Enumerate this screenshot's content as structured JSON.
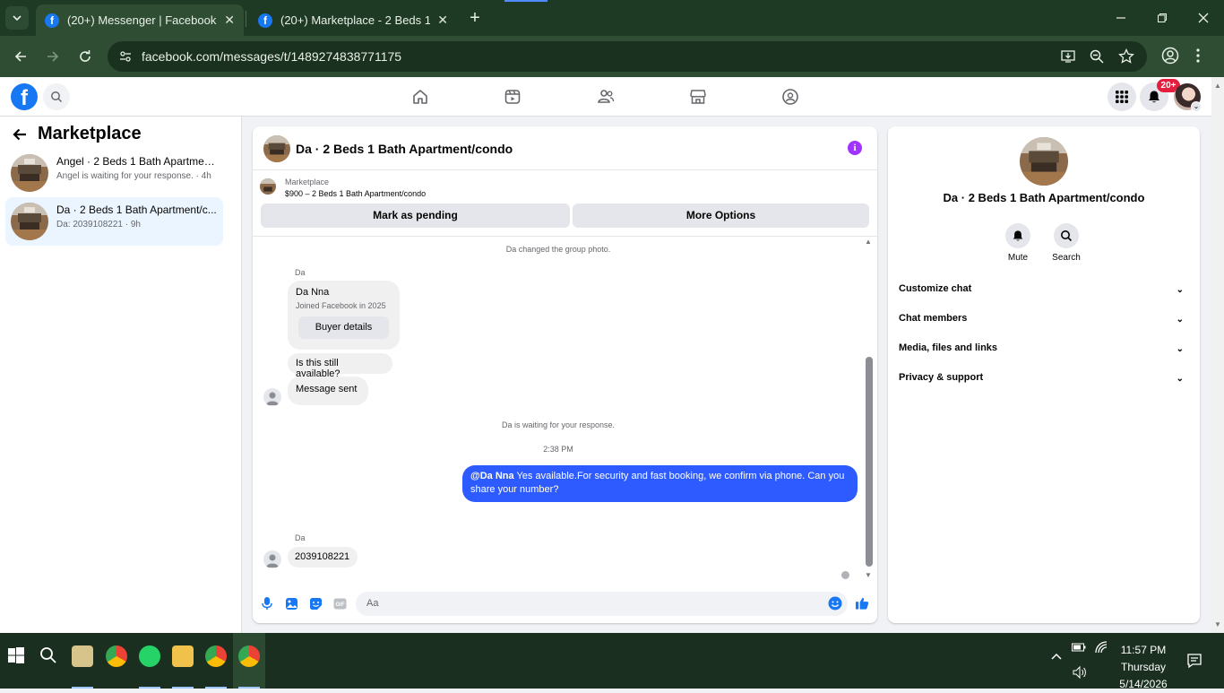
{
  "browser": {
    "tabs": [
      {
        "title": "(20+) Messenger | Facebook",
        "active": true
      },
      {
        "title": "(20+) Marketplace - 2 Beds 1 Ba",
        "active": false
      }
    ],
    "url": "facebook.com/messages/t/1489274838771175"
  },
  "header": {
    "notif_badge": "20+",
    "nav": [
      "home",
      "video",
      "friends",
      "marketplace",
      "groups"
    ]
  },
  "sidebar": {
    "title": "Marketplace",
    "conversations": [
      {
        "name": "Angel · 2 Beds 1 Bath Apartmen...",
        "subtitle": "Angel is waiting for your response. · 4h",
        "selected": false
      },
      {
        "name": "Da · 2 Beds 1 Bath Apartment/c...",
        "subtitle": "Da: 2039108221 · 9h",
        "selected": true
      }
    ]
  },
  "chat": {
    "title": "Da · 2 Beds 1 Bath Apartment/condo",
    "listing_label": "Marketplace",
    "listing_price": "$900 – 2 Beds 1 Bath Apartment/condo",
    "mark_pending": "Mark as pending",
    "more_options": "More Options",
    "sys_group_photo": "Da changed the group photo.",
    "sender_1": "Da",
    "card_name": "Da Nna",
    "card_joined": "Joined Facebook in 2025",
    "card_button": "Buyer details",
    "msg_still_available": "Is this still available?",
    "msg_sent": "Message sent",
    "sys_waiting": "Da is waiting for your response.",
    "time": "2:38 PM",
    "out_mention": "@Da Nna",
    "out_text": " Yes available.For security and fast booking, we confirm via phone. Can you share your number?",
    "sender_2": "Da",
    "msg_number": "2039108221",
    "input_placeholder": "Aa"
  },
  "info_panel": {
    "title": "Da · 2 Beds 1 Bath Apartment/condo",
    "mute": "Mute",
    "search": "Search",
    "rows": [
      "Customize chat",
      "Chat members",
      "Media, files and links",
      "Privacy & support"
    ]
  },
  "taskbar": {
    "time": "11:57 PM",
    "day": "Thursday",
    "date": "5/14/2026"
  },
  "colors": {
    "fb_blue": "#1877f2",
    "outgoing_bubble": "#2e5bff",
    "selected_conv": "#ebf5ff",
    "info_icon": "#a033ff",
    "chrome_tab_bg": "#1f3a24"
  }
}
